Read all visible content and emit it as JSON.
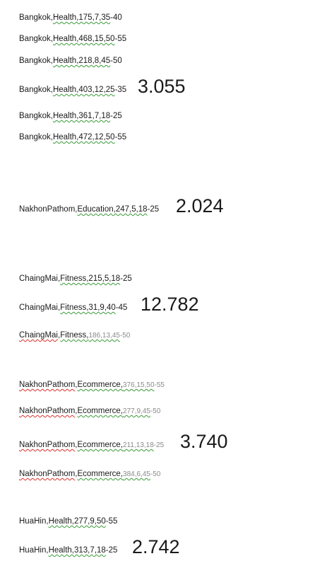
{
  "lines": [
    {
      "segments": [
        {
          "text": "Bangkok,",
          "style": "normal"
        },
        {
          "text": "Health,175,7,35",
          "style": "green"
        },
        {
          "text": "-40",
          "style": "normal"
        }
      ]
    },
    {
      "segments": [
        {
          "text": "Bangkok,",
          "style": "normal"
        },
        {
          "text": "Health,468,15,50",
          "style": "green"
        },
        {
          "text": "-55",
          "style": "normal"
        }
      ]
    },
    {
      "segments": [
        {
          "text": "Bangkok,",
          "style": "normal"
        },
        {
          "text": "Health,218,8,45",
          "style": "green"
        },
        {
          "text": "-50",
          "style": "normal"
        }
      ]
    },
    {
      "segments": [
        {
          "text": "Bangkok,",
          "style": "normal"
        },
        {
          "text": "Health,403,12,25",
          "style": "green"
        },
        {
          "text": "-35",
          "style": "normal"
        }
      ]
    },
    {
      "segments": [
        {
          "text": "Bangkok,",
          "style": "normal"
        },
        {
          "text": "Health,361,7,18",
          "style": "green"
        },
        {
          "text": "-25",
          "style": "normal"
        }
      ]
    },
    {
      "segments": [
        {
          "text": "Bangkok,",
          "style": "normal"
        },
        {
          "text": "Health,472,12,50",
          "style": "green"
        },
        {
          "text": "-55",
          "style": "normal"
        }
      ]
    },
    {
      "segments": [
        {
          "text": "NakhonPathom,",
          "style": "normal"
        },
        {
          "text": "Education,247,5,18",
          "style": "green"
        },
        {
          "text": "-25",
          "style": "normal"
        }
      ]
    },
    {
      "segments": [
        {
          "text": "ChaingMai,",
          "style": "normal"
        },
        {
          "text": "Fitness,215,5,18",
          "style": "green"
        },
        {
          "text": "-25",
          "style": "normal"
        }
      ]
    },
    {
      "segments": [
        {
          "text": "ChaingMai,",
          "style": "normal"
        },
        {
          "text": "Fitness,31,9,40",
          "style": "green"
        },
        {
          "text": "-45",
          "style": "normal"
        }
      ]
    },
    {
      "segments": [
        {
          "text": "ChaingMai",
          "style": "red"
        },
        {
          "text": ",",
          "style": "normal"
        },
        {
          "text": "Fitness,",
          "style": "green"
        },
        {
          "text": "186,13,45",
          "style": "dim-green"
        },
        {
          "text": "-50",
          "style": "dim"
        }
      ]
    },
    {
      "segments": [
        {
          "text": "NakhonPathom",
          "style": "red"
        },
        {
          "text": ",",
          "style": "normal"
        },
        {
          "text": "Ecommerce,",
          "style": "green"
        },
        {
          "text": "376,15,50",
          "style": "dim-green"
        },
        {
          "text": "-55",
          "style": "dim"
        }
      ]
    },
    {
      "segments": [
        {
          "text": "NakhonPathom",
          "style": "red"
        },
        {
          "text": ",",
          "style": "normal"
        },
        {
          "text": "Ecommerce,",
          "style": "green"
        },
        {
          "text": "277,9,45",
          "style": "dim-green"
        },
        {
          "text": "-50",
          "style": "dim"
        }
      ]
    },
    {
      "segments": [
        {
          "text": "NakhonPathom",
          "style": "red"
        },
        {
          "text": ",",
          "style": "normal"
        },
        {
          "text": "Ecommerce,",
          "style": "green"
        },
        {
          "text": "211,13,18",
          "style": "dim-green"
        },
        {
          "text": "-25",
          "style": "dim"
        }
      ]
    },
    {
      "segments": [
        {
          "text": "NakhonPathom",
          "style": "red"
        },
        {
          "text": ",",
          "style": "normal"
        },
        {
          "text": "Ecommerce,",
          "style": "green"
        },
        {
          "text": "384,6,45",
          "style": "dim-green"
        },
        {
          "text": "-50",
          "style": "dim"
        }
      ]
    },
    {
      "segments": [
        {
          "text": "HuaHin,",
          "style": "normal"
        },
        {
          "text": "Health,277,9,50",
          "style": "green"
        },
        {
          "text": "-55",
          "style": "normal"
        }
      ]
    },
    {
      "segments": [
        {
          "text": "HuaHin,",
          "style": "normal"
        },
        {
          "text": "Health,313,7,18",
          "style": "green"
        },
        {
          "text": "-25",
          "style": "normal"
        }
      ]
    }
  ],
  "annotations": [
    {
      "text": "3.055"
    },
    {
      "text": "2.024"
    },
    {
      "text": "12.782"
    },
    {
      "text": "3.740"
    },
    {
      "text": "2.742"
    }
  ],
  "colors": {
    "text": "#1a1a1a",
    "dim_text": "#8a8a8a",
    "spell_underline": "#d9302c",
    "grammar_underline": "#3a9a3a"
  }
}
